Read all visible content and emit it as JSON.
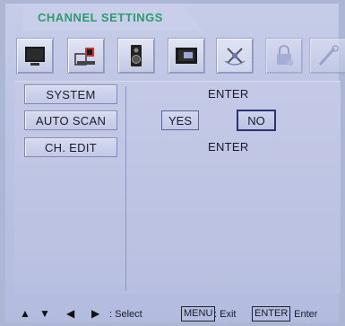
{
  "title": "CHANNEL SETTINGS",
  "icons": [
    {
      "name": "tv-picture-icon",
      "state": "normal"
    },
    {
      "name": "channel-setup-icon",
      "state": "normal"
    },
    {
      "name": "speaker-icon",
      "state": "normal"
    },
    {
      "name": "display-screen-icon",
      "state": "normal"
    },
    {
      "name": "channel-settings-icon",
      "state": "active"
    },
    {
      "name": "lock-icon",
      "state": "faded"
    },
    {
      "name": "tools-icon",
      "state": "faded"
    }
  ],
  "menu": [
    {
      "label": "SYSTEM",
      "value": "ENTER"
    },
    {
      "label": "AUTO SCAN",
      "options": [
        "YES",
        "NO"
      ],
      "selected": "NO"
    },
    {
      "label": "CH. EDIT",
      "value": "ENTER"
    }
  ],
  "footer": {
    "select_label": ": Select",
    "menu_key": "MENU",
    "exit_label": ": Exit",
    "enter_key": "ENTER",
    "enter_label": ": Enter"
  },
  "colors": {
    "title": "#2a9d6a",
    "background": "#bcc3e3"
  }
}
